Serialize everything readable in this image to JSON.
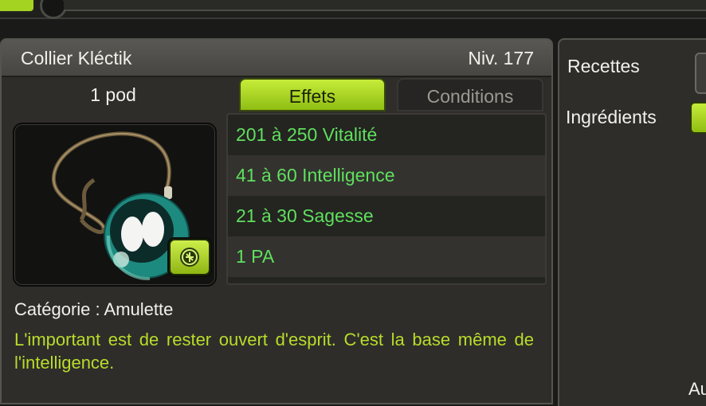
{
  "item": {
    "name": "Collier Kléctik",
    "level": "Niv. 177",
    "weight": "1 pod",
    "category": "Catégorie : Amulette",
    "description": "L'important est de rester ouvert d'esprit. C'est la base même de l'intelligence.",
    "image_icon": "amulet-necklace-icon",
    "badge_icon": "item-type-badge-icon"
  },
  "tabs": [
    {
      "label": "Effets",
      "active": true
    },
    {
      "label": "Conditions",
      "active": false
    }
  ],
  "effects": [
    {
      "text": "201 à 250 Vitalité"
    },
    {
      "text": "41 à 60 Intelligence"
    },
    {
      "text": "21 à 30 Sagesse"
    },
    {
      "text": "1 PA"
    }
  ],
  "right_panel": {
    "recipes_label": "Recettes",
    "ingredients_label": "Ingrédients",
    "truncated_text": "Au"
  },
  "colors": {
    "accent_green": "#a4d321",
    "effect_text": "#5fe05d",
    "description_text": "#b8dc2a"
  }
}
